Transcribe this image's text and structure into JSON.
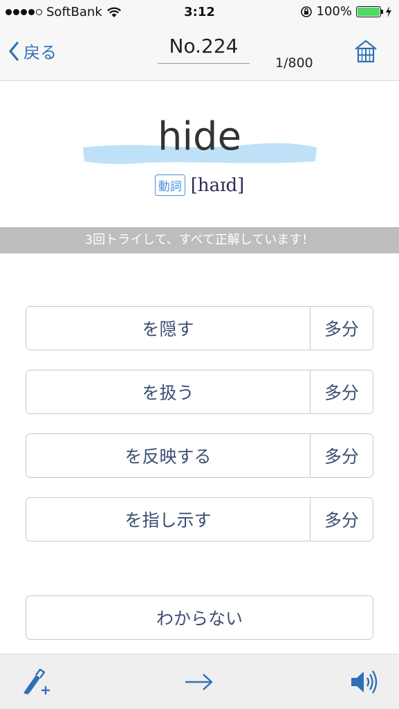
{
  "status_bar": {
    "carrier": "SoftBank",
    "time": "3:12",
    "battery": "100%"
  },
  "nav": {
    "back_label": "戻る",
    "title": "No.224",
    "counter": "1/800"
  },
  "word": {
    "text": "hide",
    "part_of_speech": "動詞",
    "pronunciation": "[haɪd]"
  },
  "status_message": "3回トライして、すべて正解しています！",
  "answers": [
    {
      "label": "を隠す",
      "maybe": "多分"
    },
    {
      "label": "を扱う",
      "maybe": "多分"
    },
    {
      "label": "を反映する",
      "maybe": "多分"
    },
    {
      "label": "を指し示す",
      "maybe": "多分"
    }
  ],
  "unknown_label": "わからない",
  "toolbar": {
    "left_icon": "highlighter-add-icon",
    "center_icon": "arrow-right-icon",
    "right_icon": "speaker-icon"
  },
  "colors": {
    "accent": "#2e6fb7",
    "answer_text": "#3a4f73",
    "highlight": "#bfe1f7",
    "strip": "#bdbdbd",
    "battery": "#4cd964"
  }
}
